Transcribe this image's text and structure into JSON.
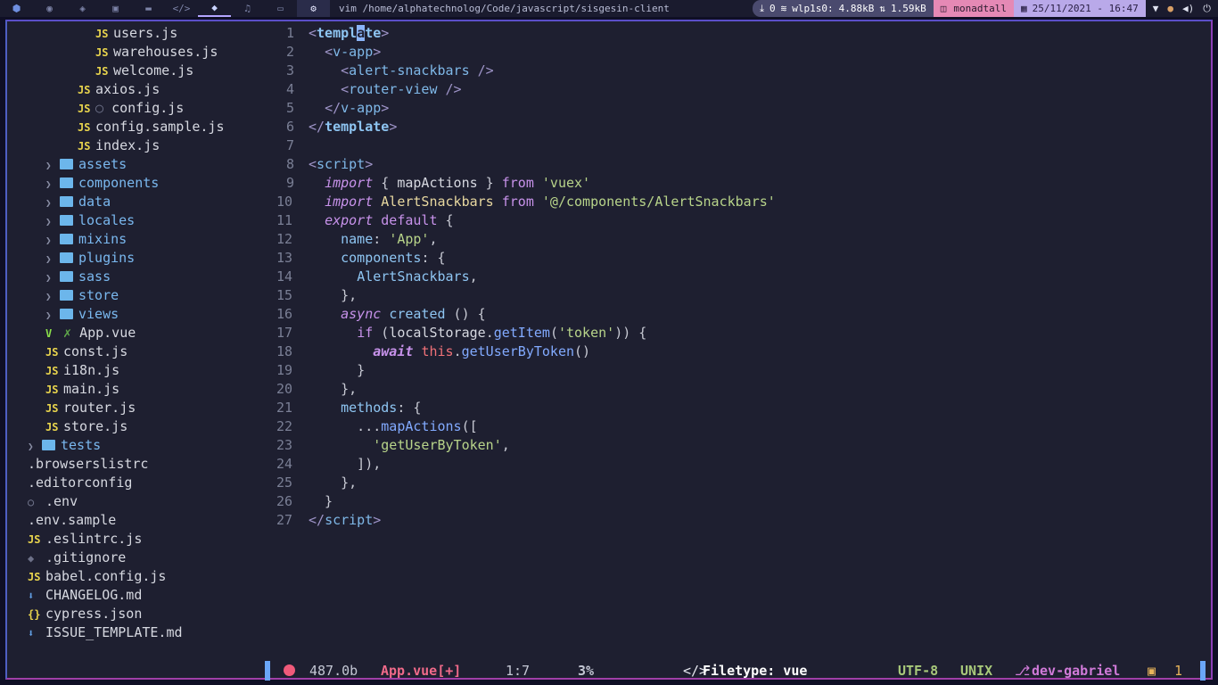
{
  "topbar": {
    "workspaces": [
      {
        "icon": "python-icon"
      },
      {
        "icon": "chrome-icon"
      },
      {
        "icon": "cube-icon"
      },
      {
        "icon": "terminal-window-icon"
      },
      {
        "icon": "folder-icon"
      },
      {
        "icon": "code-icon"
      },
      {
        "icon": "layers-icon",
        "active": true
      },
      {
        "icon": "music-icon"
      },
      {
        "icon": "display-icon"
      },
      {
        "icon": "gear-icon",
        "current": true
      }
    ],
    "window_title": "vim /home/alphatechnolog/Code/javascript/sisgesin-client",
    "updates": "0",
    "net_iface": "wlp1s0:",
    "net_down": "4.88kB",
    "net_up": "1.59kB",
    "layout": "monadtall",
    "datetime": "25/11/2021 - 16:47",
    "colors": {
      "net_bg": "#4a4a6e",
      "layout_bg": "#e589b5",
      "date_bg": "#b9a9e9",
      "accent": "#b4a5ff"
    }
  },
  "tree": [
    {
      "indent": 1,
      "type": "js",
      "name": "users.js"
    },
    {
      "indent": 1,
      "type": "js",
      "name": "warehouses.js"
    },
    {
      "indent": 1,
      "type": "js",
      "name": "welcome.js"
    },
    {
      "indent": 0,
      "type": "js",
      "name": "axios.js"
    },
    {
      "indent": 0,
      "type": "js",
      "name": "config.js",
      "ignored": true
    },
    {
      "indent": 0,
      "type": "js",
      "name": "config.sample.js"
    },
    {
      "indent": 0,
      "type": "js",
      "name": "index.js"
    },
    {
      "indent": -1,
      "type": "folder",
      "name": "assets"
    },
    {
      "indent": -1,
      "type": "folder",
      "name": "components"
    },
    {
      "indent": -1,
      "type": "folder",
      "name": "data"
    },
    {
      "indent": -1,
      "type": "folder",
      "name": "locales"
    },
    {
      "indent": -1,
      "type": "folder",
      "name": "mixins"
    },
    {
      "indent": -1,
      "type": "folder",
      "name": "plugins"
    },
    {
      "indent": -1,
      "type": "folder",
      "name": "sass"
    },
    {
      "indent": -1,
      "type": "folder",
      "name": "store"
    },
    {
      "indent": -1,
      "type": "folder",
      "name": "views"
    },
    {
      "indent": -1,
      "type": "vue",
      "name": "App.vue",
      "modified": true
    },
    {
      "indent": -1,
      "type": "js",
      "name": "const.js"
    },
    {
      "indent": -1,
      "type": "js",
      "name": "i18n.js"
    },
    {
      "indent": -1,
      "type": "js",
      "name": "main.js"
    },
    {
      "indent": -1,
      "type": "js",
      "name": "router.js"
    },
    {
      "indent": -1,
      "type": "js",
      "name": "store.js"
    },
    {
      "indent": -2,
      "type": "folder",
      "name": "tests"
    },
    {
      "indent": -2,
      "type": "plain",
      "name": ".browserslistrc"
    },
    {
      "indent": -2,
      "type": "plain",
      "name": ".editorconfig"
    },
    {
      "indent": -2,
      "type": "dot",
      "name": ".env"
    },
    {
      "indent": -2,
      "type": "plain",
      "name": ".env.sample"
    },
    {
      "indent": -2,
      "type": "js",
      "name": ".eslintrc.js"
    },
    {
      "indent": -2,
      "type": "git",
      "name": ".gitignore"
    },
    {
      "indent": -2,
      "type": "js",
      "name": "babel.config.js"
    },
    {
      "indent": -2,
      "type": "md",
      "name": "CHANGELOG.md"
    },
    {
      "indent": -2,
      "type": "json",
      "name": "cypress.json"
    },
    {
      "indent": -2,
      "type": "md",
      "name": "ISSUE_TEMPLATE.md"
    }
  ],
  "editor": {
    "line_numbers": [
      "1",
      "2",
      "3",
      "4",
      "5",
      "6",
      "7",
      "8",
      "9",
      "10",
      "11",
      "12",
      "13",
      "14",
      "15",
      "16",
      "17",
      "18",
      "19",
      "20",
      "21",
      "22",
      "23",
      "24",
      "25",
      "26",
      "27"
    ]
  },
  "statusline": {
    "size": "487.0b",
    "filename": "App.vue[+]",
    "position": "1:7",
    "percent": "3%",
    "filetype_label": "Filetype: vue",
    "encoding": "UTF-8",
    "format": "UNIX",
    "branch": "dev-gabriel",
    "buffers": "1"
  }
}
